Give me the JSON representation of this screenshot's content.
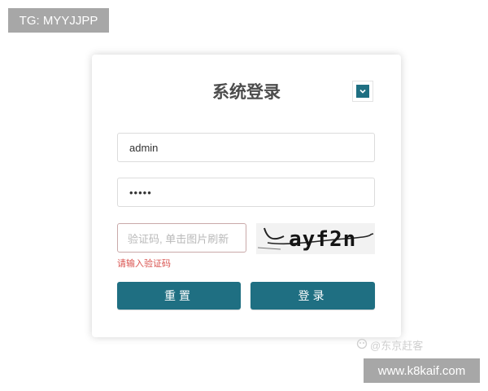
{
  "overlay": {
    "tg_label": "TG: MYYJJPP",
    "site_label": "www.k8kaif.com",
    "watermark": "@东京赶客"
  },
  "login": {
    "title": "系统登录",
    "username_value": "admin",
    "password_value": "•••••",
    "captcha_placeholder": "验证码, 单击图片刷新",
    "captcha_code": "ayf2n",
    "captcha_error": "请输入验证码",
    "reset_label": "重置",
    "login_label": "登录",
    "icon": "chevron-down-icon"
  },
  "colors": {
    "accent": "#1f6f82",
    "error": "#d9534f",
    "badge": "#a7a7a7"
  }
}
